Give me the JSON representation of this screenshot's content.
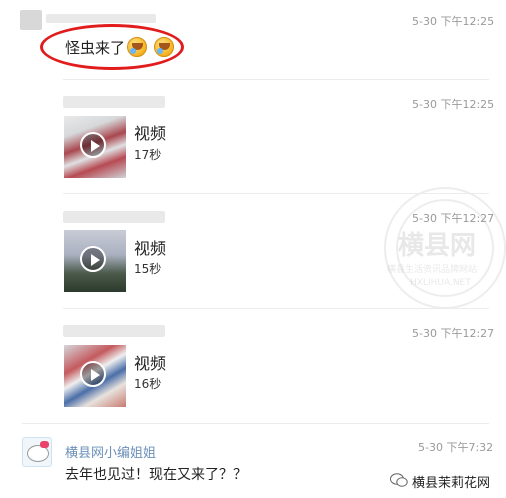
{
  "messages": [
    {
      "time": "5-30 下午12:25",
      "text": "怪虫来了"
    },
    {
      "time": "5-30 下午12:25",
      "video_title": "视频",
      "duration": "17秒"
    },
    {
      "time": "5-30 下午12:27",
      "video_title": "视频",
      "duration": "15秒"
    },
    {
      "time": "5-30 下午12:27",
      "video_title": "视频",
      "duration": "16秒"
    },
    {
      "time": "5-30 下午7:32",
      "sender": "横县网小编姐姐",
      "text": "去年也见过！现在又来了？？"
    }
  ],
  "watermark": {
    "title": "横县网",
    "subtitle": "横县生活资讯品牌网站",
    "url": "HXLIHUA.NET",
    "corner": "横县茉莉花网"
  },
  "colors": {
    "highlight_ring": "#e11c1c",
    "sender_name": "#6b8fb8"
  }
}
